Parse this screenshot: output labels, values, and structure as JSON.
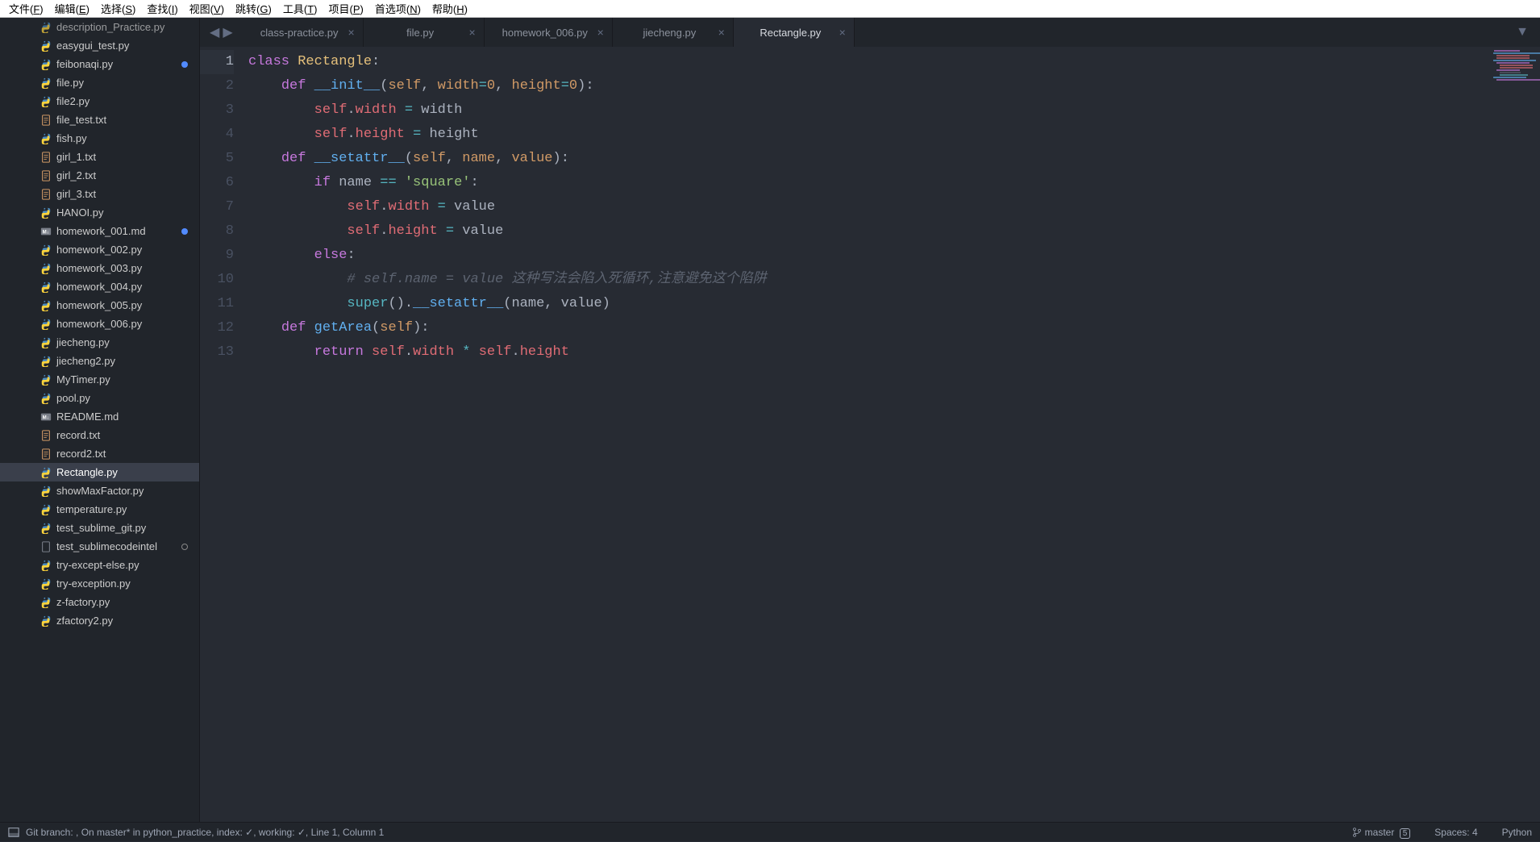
{
  "menubar": [
    "文件(F)",
    "编辑(E)",
    "选择(S)",
    "查找(I)",
    "视图(V)",
    "跳转(G)",
    "工具(T)",
    "项目(P)",
    "首选项(N)",
    "帮助(H)"
  ],
  "sidebar": {
    "items": [
      {
        "name": "description_Practice.py",
        "icon": "python",
        "cut": true
      },
      {
        "name": "easygui_test.py",
        "icon": "python"
      },
      {
        "name": "feibonaqi.py",
        "icon": "python",
        "modified": true
      },
      {
        "name": "file.py",
        "icon": "python"
      },
      {
        "name": "file2.py",
        "icon": "python"
      },
      {
        "name": "file_test.txt",
        "icon": "text"
      },
      {
        "name": "fish.py",
        "icon": "python"
      },
      {
        "name": "girl_1.txt",
        "icon": "text"
      },
      {
        "name": "girl_2.txt",
        "icon": "text"
      },
      {
        "name": "girl_3.txt",
        "icon": "text"
      },
      {
        "name": "HANOI.py",
        "icon": "python"
      },
      {
        "name": "homework_001.md",
        "icon": "markdown",
        "modified": true
      },
      {
        "name": "homework_002.py",
        "icon": "python"
      },
      {
        "name": "homework_003.py",
        "icon": "python"
      },
      {
        "name": "homework_004.py",
        "icon": "python"
      },
      {
        "name": "homework_005.py",
        "icon": "python"
      },
      {
        "name": "homework_006.py",
        "icon": "python"
      },
      {
        "name": "jiecheng.py",
        "icon": "python"
      },
      {
        "name": "jiecheng2.py",
        "icon": "python"
      },
      {
        "name": "MyTimer.py",
        "icon": "python"
      },
      {
        "name": "pool.py",
        "icon": "python"
      },
      {
        "name": "README.md",
        "icon": "markdown"
      },
      {
        "name": "record.txt",
        "icon": "text"
      },
      {
        "name": "record2.txt",
        "icon": "text"
      },
      {
        "name": "Rectangle.py",
        "icon": "python",
        "active": true
      },
      {
        "name": "showMaxFactor.py",
        "icon": "python"
      },
      {
        "name": "temperature.py",
        "icon": "python"
      },
      {
        "name": "test_sublime_git.py",
        "icon": "python"
      },
      {
        "name": "test_sublimecodeintel",
        "icon": "blank",
        "open": true
      },
      {
        "name": "try-except-else.py",
        "icon": "python"
      },
      {
        "name": "try-exception.py",
        "icon": "python"
      },
      {
        "name": "z-factory.py",
        "icon": "python"
      },
      {
        "name": "zfactory2.py",
        "icon": "python"
      }
    ]
  },
  "tabs": [
    {
      "label": "class-practice.py"
    },
    {
      "label": "file.py"
    },
    {
      "label": "homework_006.py"
    },
    {
      "label": "jiecheng.py"
    },
    {
      "label": "Rectangle.py",
      "active": true
    }
  ],
  "editor": {
    "line_count": 13,
    "current_line": 1,
    "code_lines": [
      {
        "n": 1,
        "tokens": [
          [
            "kw",
            "class"
          ],
          [
            "punc",
            " "
          ],
          [
            "cls",
            "Rectangle"
          ],
          [
            "punc",
            ":"
          ]
        ]
      },
      {
        "n": 2,
        "tokens": [
          [
            "punc",
            "    "
          ],
          [
            "kw",
            "def"
          ],
          [
            "punc",
            " "
          ],
          [
            "fn",
            "__init__"
          ],
          [
            "punc",
            "("
          ],
          [
            "parm",
            "self"
          ],
          [
            "punc",
            ", "
          ],
          [
            "parm",
            "width"
          ],
          [
            "op",
            "="
          ],
          [
            "num",
            "0"
          ],
          [
            "punc",
            ", "
          ],
          [
            "parm",
            "height"
          ],
          [
            "op",
            "="
          ],
          [
            "num",
            "0"
          ],
          [
            "punc",
            "):"
          ]
        ]
      },
      {
        "n": 3,
        "tokens": [
          [
            "punc",
            "        "
          ],
          [
            "self",
            "self"
          ],
          [
            "punc",
            "."
          ],
          [
            "attr",
            "width"
          ],
          [
            "punc",
            " "
          ],
          [
            "op",
            "="
          ],
          [
            "punc",
            " width"
          ]
        ]
      },
      {
        "n": 4,
        "tokens": [
          [
            "punc",
            "        "
          ],
          [
            "self",
            "self"
          ],
          [
            "punc",
            "."
          ],
          [
            "attr",
            "height"
          ],
          [
            "punc",
            " "
          ],
          [
            "op",
            "="
          ],
          [
            "punc",
            " height"
          ]
        ]
      },
      {
        "n": 5,
        "tokens": [
          [
            "punc",
            "    "
          ],
          [
            "kw",
            "def"
          ],
          [
            "punc",
            " "
          ],
          [
            "fn",
            "__setattr__"
          ],
          [
            "punc",
            "("
          ],
          [
            "parm",
            "self"
          ],
          [
            "punc",
            ", "
          ],
          [
            "parm",
            "name"
          ],
          [
            "punc",
            ", "
          ],
          [
            "parm",
            "value"
          ],
          [
            "punc",
            "):"
          ]
        ]
      },
      {
        "n": 6,
        "tokens": [
          [
            "punc",
            "        "
          ],
          [
            "kw",
            "if"
          ],
          [
            "punc",
            " name "
          ],
          [
            "op",
            "=="
          ],
          [
            "punc",
            " "
          ],
          [
            "str",
            "'square'"
          ],
          [
            "punc",
            ":"
          ]
        ]
      },
      {
        "n": 7,
        "tokens": [
          [
            "punc",
            "            "
          ],
          [
            "self",
            "self"
          ],
          [
            "punc",
            "."
          ],
          [
            "attr",
            "width"
          ],
          [
            "punc",
            " "
          ],
          [
            "op",
            "="
          ],
          [
            "punc",
            " value"
          ]
        ]
      },
      {
        "n": 8,
        "tokens": [
          [
            "punc",
            "            "
          ],
          [
            "self",
            "self"
          ],
          [
            "punc",
            "."
          ],
          [
            "attr",
            "height"
          ],
          [
            "punc",
            " "
          ],
          [
            "op",
            "="
          ],
          [
            "punc",
            " value"
          ]
        ]
      },
      {
        "n": 9,
        "tokens": [
          [
            "punc",
            "        "
          ],
          [
            "kw",
            "else"
          ],
          [
            "punc",
            ":"
          ]
        ]
      },
      {
        "n": 10,
        "tokens": [
          [
            "punc",
            "            "
          ],
          [
            "cmt",
            "# self.name = value 这种写法会陷入死循环,注意避免这个陷阱"
          ]
        ]
      },
      {
        "n": 11,
        "tokens": [
          [
            "punc",
            "            "
          ],
          [
            "builtin",
            "super"
          ],
          [
            "punc",
            "()."
          ],
          [
            "fn",
            "__setattr__"
          ],
          [
            "punc",
            "(name, value)"
          ]
        ]
      },
      {
        "n": 12,
        "tokens": [
          [
            "punc",
            "    "
          ],
          [
            "kw",
            "def"
          ],
          [
            "punc",
            " "
          ],
          [
            "fn",
            "getArea"
          ],
          [
            "punc",
            "("
          ],
          [
            "parm",
            "self"
          ],
          [
            "punc",
            "):"
          ]
        ]
      },
      {
        "n": 13,
        "tokens": [
          [
            "punc",
            "        "
          ],
          [
            "kw",
            "return"
          ],
          [
            "punc",
            " "
          ],
          [
            "self",
            "self"
          ],
          [
            "punc",
            "."
          ],
          [
            "attr",
            "width"
          ],
          [
            "punc",
            " "
          ],
          [
            "op",
            "*"
          ],
          [
            "punc",
            " "
          ],
          [
            "self",
            "self"
          ],
          [
            "punc",
            "."
          ],
          [
            "attr",
            "height"
          ]
        ]
      }
    ]
  },
  "statusbar": {
    "left": "Git branch: , On master* in python_practice, index: ✓, working: ✓, Line 1, Column 1",
    "branch": "master",
    "branch_count": "5",
    "spaces": "Spaces: 4",
    "lang": "Python"
  }
}
